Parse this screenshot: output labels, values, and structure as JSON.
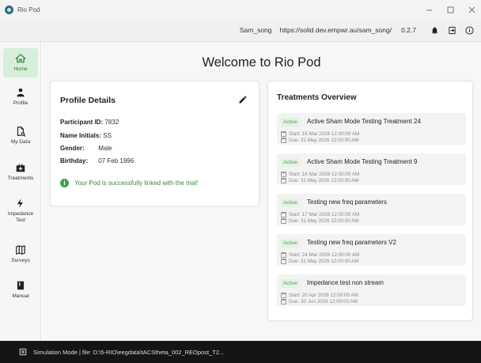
{
  "window": {
    "title": "Rio Pod"
  },
  "header": {
    "username": "Sam_song",
    "pod_url": "https://solid.dev.empwr.au/sam_song/",
    "version": "0.2.7",
    "icons": [
      "bell-icon",
      "logout-icon",
      "info-icon"
    ]
  },
  "sidebar": {
    "items": [
      {
        "label": "Home",
        "icon": "home-icon",
        "active": true
      },
      {
        "label": "Profile",
        "icon": "person-icon"
      },
      {
        "label": "My Data",
        "icon": "file-search-icon"
      },
      {
        "label": "Treatments",
        "icon": "medical-bag-icon"
      },
      {
        "label": "Impedance Test",
        "icon": "bolt-icon"
      },
      {
        "label": "Surveys",
        "icon": "map-icon"
      },
      {
        "label": "Manual",
        "icon": "book-icon"
      }
    ]
  },
  "main": {
    "welcome": "Welcome to Rio Pod",
    "profile": {
      "title": "Profile Details",
      "participant_id_label": "Participant ID:",
      "participant_id": "7832",
      "initials_label": "Name Initials:",
      "initials": "SS",
      "gender_label": "Gender:",
      "gender": "Male",
      "birthday_label": "Birthday:",
      "birthday": "07 Feb 1996",
      "linked_message": "Your Pod is successfully linked with the trial!"
    },
    "treatments": {
      "title": "Treatments Overview",
      "items": [
        {
          "status": "Active",
          "name": "Active Sham Mode Testing Treatment 24",
          "start": "Start: 16 Mar 2026 12:00:00 AM",
          "due": "Due: 31 May 2026 12:00:00 AM"
        },
        {
          "status": "Active",
          "name": "Active Sham Mode Testing Treatment 9",
          "start": "Start: 16 Mar 2026 12:00:00 AM",
          "due": "Due: 31 May 2026 12:00:00 AM"
        },
        {
          "status": "Active",
          "name": "Testing new freq parameters",
          "start": "Start: 17 Mar 2026 12:00:00 AM",
          "due": "Due: 31 May 2026 12:00:00 AM"
        },
        {
          "status": "Active",
          "name": "Testing new freq parameters V2",
          "start": "Start: 24 Mar 2026 12:00:00 AM",
          "due": "Due: 31 May 2026 12:00:00 AM"
        },
        {
          "status": "Active",
          "name": "Impedance test non stream",
          "start": "Start: 20 Apr 2026 12:00:00 AM",
          "due": "Due: 30 Jun 2026 12:00:00 AM"
        }
      ]
    }
  },
  "statusbar": {
    "text": "Simulation Mode | file: D:\\5-RIO\\eegdata\\tACStheta_002_REOpost_T2..."
  },
  "colors": {
    "accent_green": "#43a047",
    "active_nav_bg": "#d8eedc",
    "statusbar_bg": "#151515"
  }
}
